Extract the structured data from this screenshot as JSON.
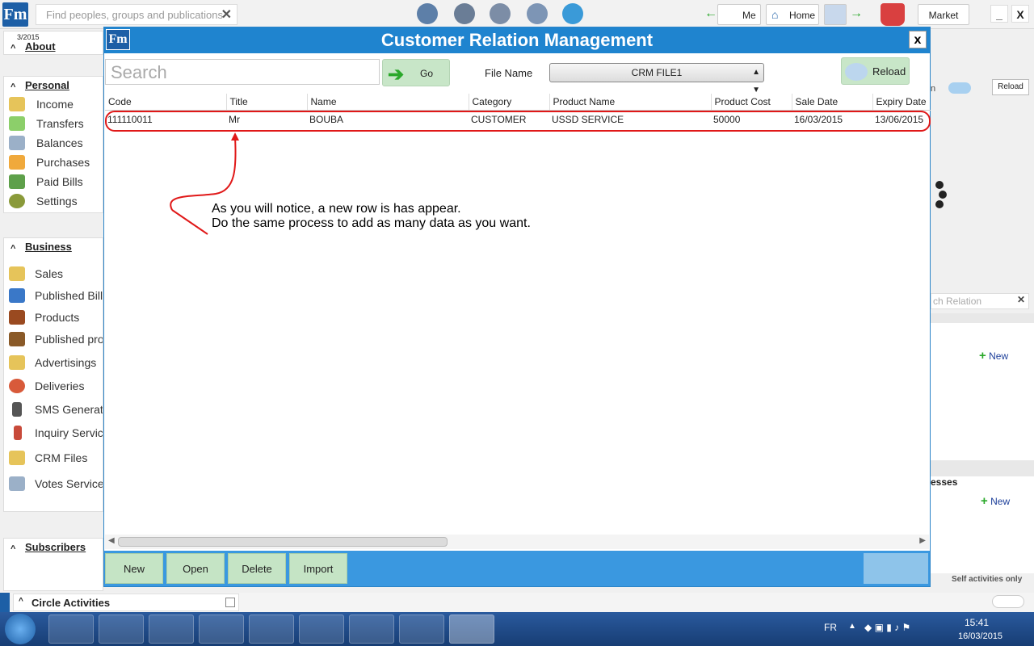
{
  "topbar": {
    "search_placeholder": "Find peoples, groups and publications",
    "me_label": "Me",
    "home_label": "Home",
    "market_label": "Market",
    "minimize": "_",
    "close": "X"
  },
  "app_logo": "Fm",
  "sidebar": {
    "date_fragment": "3/2015",
    "about_label": "About",
    "personal": {
      "title": "Personal",
      "items": [
        "Income",
        "Transfers",
        "Balances",
        "Purchases",
        "Paid Bills",
        "Settings"
      ]
    },
    "business": {
      "title": "Business",
      "items": [
        "Sales",
        "Published Bills",
        "Products",
        "Published prod",
        "Advertisings",
        "Deliveries",
        "SMS Generato",
        "Inquiry Servic",
        "CRM Files",
        "Votes Service"
      ]
    },
    "subscribers_label": "Subscribers"
  },
  "right_panel": {
    "reload_label": "Reload",
    "toggle_fragment": "n",
    "search_fragment": "ch Relation",
    "new_label": "New",
    "new_label_2": "New",
    "processes_fragment": "esses",
    "self_activities": "Self activities only"
  },
  "dialog": {
    "title": "Customer Relation Management",
    "close_label": "x",
    "search_placeholder": "Search",
    "go_label": "Go",
    "file_name_label": "File Name",
    "file_selected": "CRM FILE1",
    "reload_label": "Reload",
    "columns": [
      "Code",
      "Title",
      "Name",
      "Category",
      "Product Name",
      "Product Cost",
      "Sale Date",
      "Expiry Date"
    ],
    "rows": [
      [
        "111110011",
        "Mr",
        "BOUBA",
        "CUSTOMER",
        "USSD SERVICE",
        "50000",
        "16/03/2015",
        "13/06/2015"
      ]
    ],
    "annotation_line1": "As you will notice, a new row is has appear.",
    "annotation_line2": "Do the same process to add as many data as you want.",
    "bottom_buttons": [
      "New",
      "Open",
      "Delete",
      "Import"
    ],
    "accent_color": "#1f84cf",
    "highlight_color": "#e01818"
  },
  "circle_activities": {
    "title": "Circle Activities"
  },
  "taskbar": {
    "language": "FR",
    "time": "15:41",
    "date": "16/03/2015"
  }
}
